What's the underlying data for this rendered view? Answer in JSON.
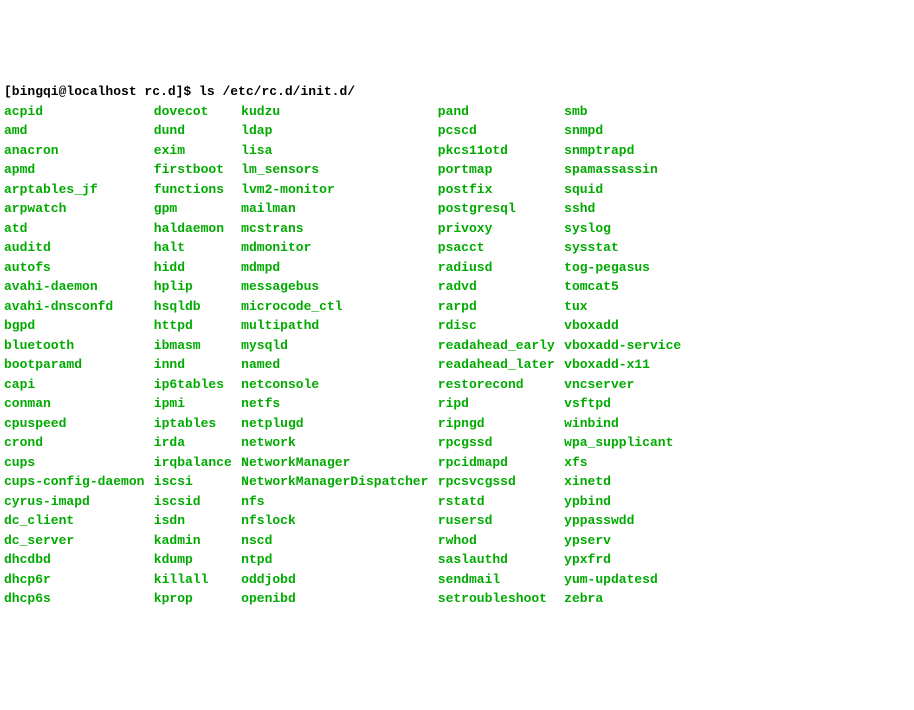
{
  "prompt_user": "[bingqi@localhost rc.d]$ ",
  "command": "ls /etc/rc.d/init.d/",
  "columns": [
    [
      "acpid",
      "amd",
      "anacron",
      "apmd",
      "arptables_jf",
      "arpwatch",
      "atd",
      "auditd",
      "autofs",
      "avahi-daemon",
      "avahi-dnsconfd",
      "bgpd",
      "bluetooth",
      "bootparamd",
      "capi",
      "conman",
      "cpuspeed",
      "crond",
      "cups",
      "cups-config-daemon",
      "cyrus-imapd",
      "dc_client",
      "dc_server",
      "dhcdbd",
      "dhcp6r",
      "dhcp6s"
    ],
    [
      "dovecot",
      "dund",
      "exim",
      "firstboot",
      "functions",
      "gpm",
      "haldaemon",
      "halt",
      "hidd",
      "hplip",
      "hsqldb",
      "httpd",
      "ibmasm",
      "innd",
      "ip6tables",
      "ipmi",
      "iptables",
      "irda",
      "irqbalance",
      "iscsi",
      "iscsid",
      "isdn",
      "kadmin",
      "kdump",
      "killall",
      "kprop"
    ],
    [
      "kudzu",
      "ldap",
      "lisa",
      "lm_sensors",
      "lvm2-monitor",
      "mailman",
      "mcstrans",
      "mdmonitor",
      "mdmpd",
      "messagebus",
      "microcode_ctl",
      "multipathd",
      "mysqld",
      "named",
      "netconsole",
      "netfs",
      "netplugd",
      "network",
      "NetworkManager",
      "NetworkManagerDispatcher",
      "nfs",
      "nfslock",
      "nscd",
      "ntpd",
      "oddjobd",
      "openibd"
    ],
    [
      "pand",
      "pcscd",
      "pkcs11otd",
      "portmap",
      "postfix",
      "postgresql",
      "privoxy",
      "psacct",
      "radiusd",
      "radvd",
      "rarpd",
      "rdisc",
      "readahead_early",
      "readahead_later",
      "restorecond",
      "ripd",
      "ripngd",
      "rpcgssd",
      "rpcidmapd",
      "rpcsvcgssd",
      "rstatd",
      "rusersd",
      "rwhod",
      "saslauthd",
      "sendmail",
      "setroubleshoot"
    ],
    [
      "smb",
      "snmpd",
      "snmptrapd",
      "spamassassin",
      "squid",
      "sshd",
      "syslog",
      "sysstat",
      "tog-pegasus",
      "tomcat5",
      "tux",
      "vboxadd",
      "vboxadd-service",
      "vboxadd-x11",
      "vncserver",
      "vsftpd",
      "winbind",
      "wpa_supplicant",
      "xfs",
      "xinetd",
      "ypbind",
      "yppasswdd",
      "ypserv",
      "ypxfrd",
      "yum-updatesd",
      "zebra"
    ]
  ]
}
